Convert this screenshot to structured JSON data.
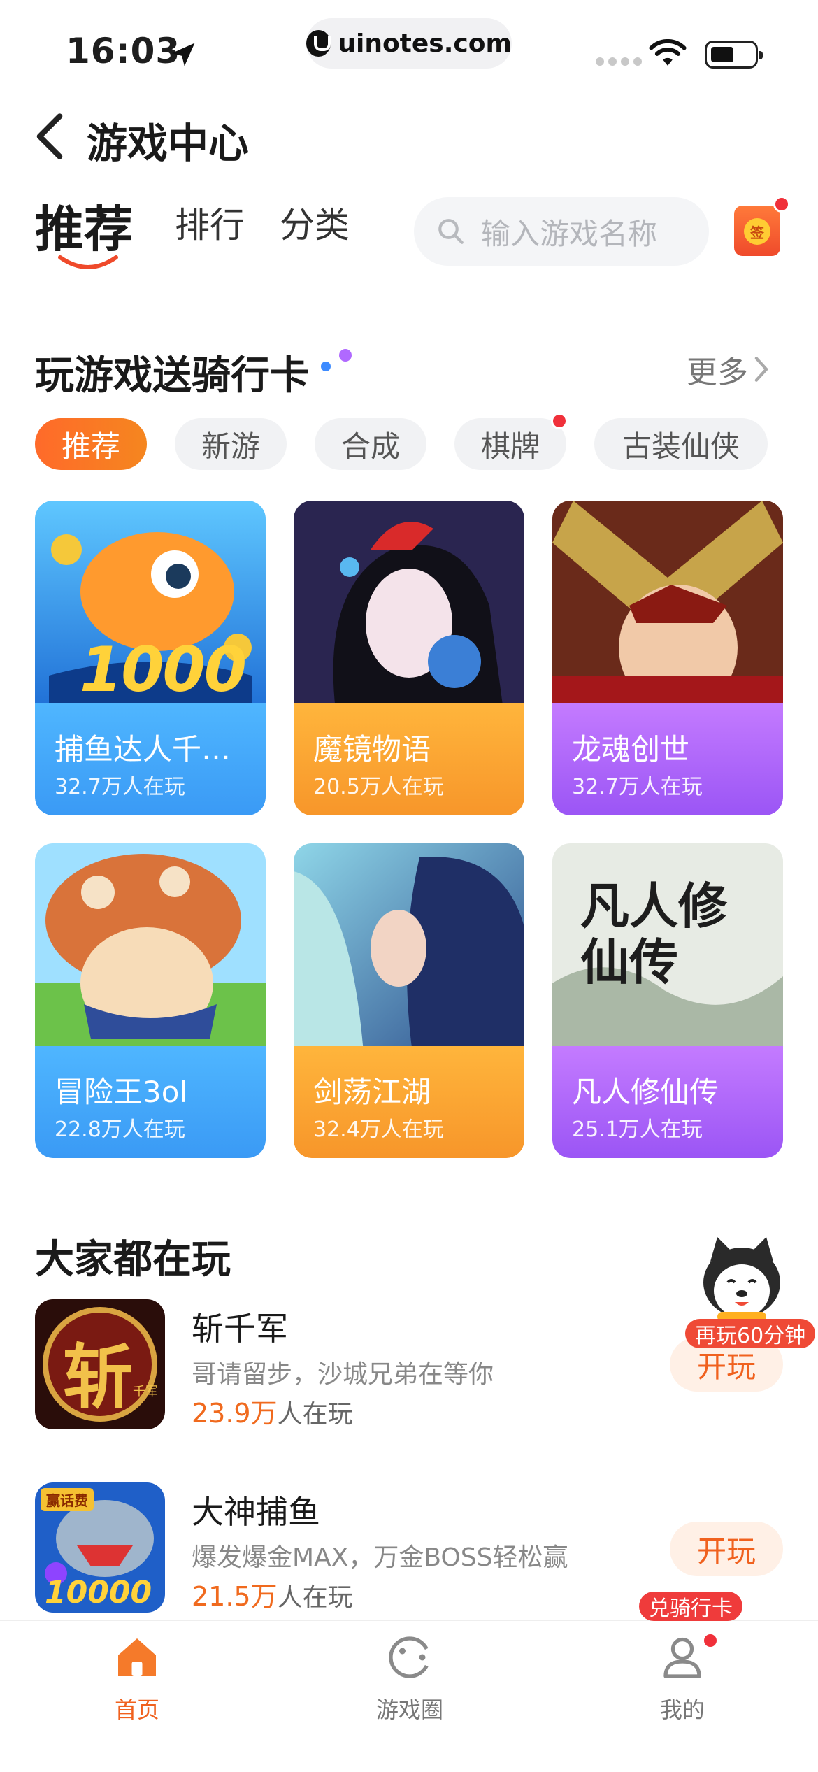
{
  "status_bar": {
    "time": "16:03",
    "url": "uinotes.com"
  },
  "header": {
    "title": "游戏中心"
  },
  "tabs": {
    "items": [
      {
        "label": "推荐"
      },
      {
        "label": "排行"
      },
      {
        "label": "分类"
      }
    ],
    "active": "推荐"
  },
  "search": {
    "placeholder": "输入游戏名称"
  },
  "sign_in": {
    "icon_text": "签"
  },
  "section1": {
    "title": "玩游戏送骑行卡",
    "more": "更多",
    "chips": [
      {
        "label": "推荐",
        "active": true
      },
      {
        "label": "新游",
        "active": false
      },
      {
        "label": "合成",
        "active": false
      },
      {
        "label": "棋牌",
        "active": false
      },
      {
        "label": "古装仙侠",
        "active": false
      }
    ],
    "games": [
      {
        "name": "捕鱼达人千…",
        "players": "32.7万人在玩",
        "art_text": "1000"
      },
      {
        "name": "魔镜物语",
        "players": "20.5万人在玩"
      },
      {
        "name": "龙魂创世",
        "players": "32.7万人在玩"
      },
      {
        "name": "冒险王3ol",
        "players": "22.8万人在玩"
      },
      {
        "name": "剑荡江湖",
        "players": "32.4万人在玩"
      },
      {
        "name": "凡人修仙传",
        "players": "25.1万人在玩",
        "art_text": "凡人修仙传"
      }
    ]
  },
  "section2": {
    "title": "大家都在玩",
    "items": [
      {
        "name": "斩千军",
        "desc": "哥请留步，沙城兄弟在等你",
        "count_num": "23.9万",
        "count_suffix": "人在玩",
        "button": "开玩",
        "icon_text": "斩",
        "icon_sub": "千军"
      },
      {
        "name": "大神捕鱼",
        "desc": "爆发爆金MAX，万金BOSS轻松赢",
        "count_num": "21.5万",
        "count_suffix": "人在玩",
        "button": "开玩",
        "icon_text": "10000",
        "icon_badge": "赢话费"
      }
    ],
    "float_badge": "再玩60分钟",
    "card_badge": "兑骑行卡"
  },
  "bottom_nav": {
    "items": [
      {
        "label": "首页"
      },
      {
        "label": "游戏圈"
      },
      {
        "label": "我的"
      }
    ],
    "active": "首页"
  },
  "colors": {
    "accent": "#f0611e",
    "red_dot": "#f0303a",
    "blue_band": "#3a9af5",
    "orange_band": "#f7962a",
    "purple_band": "#9b55f5"
  }
}
